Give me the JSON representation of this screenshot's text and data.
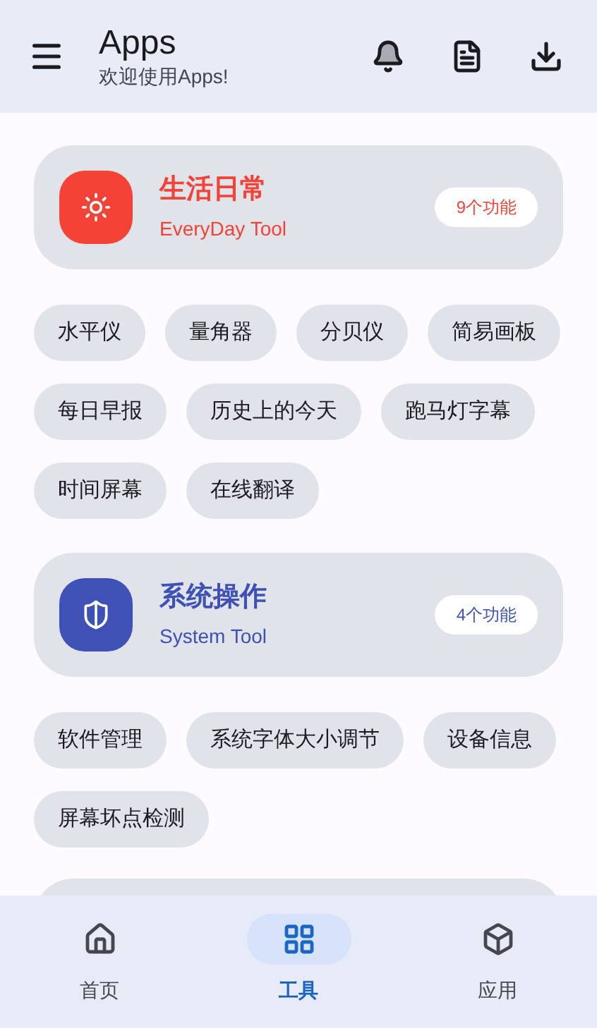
{
  "app_bar": {
    "title": "Apps",
    "subtitle": "欢迎使用Apps!"
  },
  "categories": [
    {
      "kind": "sun",
      "title": "生活日常",
      "subtitle": "EveryDay Tool",
      "count": "9个功能",
      "color": "#f44336",
      "tools": [
        "水平仪",
        "量角器",
        "分贝仪",
        "简易画板",
        "每日早报",
        "历史上的今天",
        "跑马灯字幕",
        "时间屏幕",
        "在线翻译"
      ]
    },
    {
      "kind": "shield",
      "title": "系统操作",
      "subtitle": "System Tool",
      "count": "4个功能",
      "color": "#3f51b5",
      "tools": [
        "软件管理",
        "系统字体大小调节",
        "设备信息",
        "屏幕坏点检测"
      ]
    }
  ],
  "bottom_nav": [
    {
      "kind": "home",
      "label": "首页",
      "selected": false
    },
    {
      "kind": "tools",
      "label": "工具",
      "selected": true
    },
    {
      "kind": "apps",
      "label": "应用",
      "selected": false
    }
  ]
}
